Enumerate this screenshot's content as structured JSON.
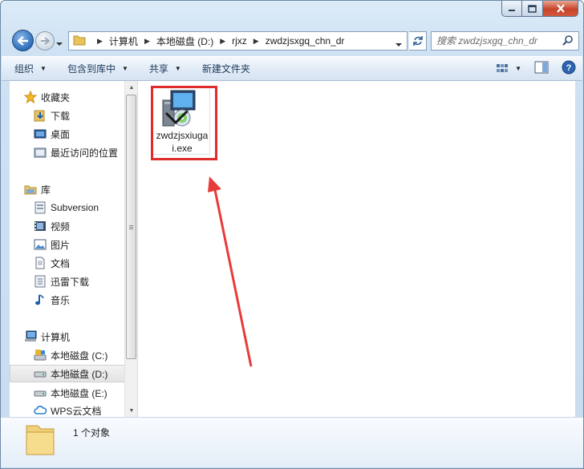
{
  "address": {
    "breadcrumbs": [
      "计算机",
      "本地磁盘 (D:)",
      "rjxz",
      "zwdzjsxgq_chn_dr"
    ]
  },
  "search": {
    "placeholder": "搜索 zwdzjsxgq_chn_dr"
  },
  "toolbar": {
    "organize": "组织",
    "include_in_library": "包含到库中",
    "share": "共享",
    "new_folder": "新建文件夹"
  },
  "sidebar": {
    "items": [
      {
        "label": "收藏夹",
        "icon": "star-icon"
      },
      {
        "label": "下载",
        "icon": "download-folder-icon"
      },
      {
        "label": "桌面",
        "icon": "desktop-icon"
      },
      {
        "label": "最近访问的位置",
        "icon": "recent-places-icon"
      },
      {
        "label": "库",
        "icon": "library-icon"
      },
      {
        "label": "Subversion",
        "icon": "subversion-icon"
      },
      {
        "label": "视频",
        "icon": "video-icon"
      },
      {
        "label": "图片",
        "icon": "picture-icon"
      },
      {
        "label": "文档",
        "icon": "document-icon"
      },
      {
        "label": "迅雷下载",
        "icon": "xunlei-download-icon"
      },
      {
        "label": "音乐",
        "icon": "music-icon"
      },
      {
        "label": "计算机",
        "icon": "computer-icon"
      },
      {
        "label": "本地磁盘 (C:)",
        "icon": "system-drive-icon"
      },
      {
        "label": "本地磁盘 (D:)",
        "icon": "drive-icon"
      },
      {
        "label": "本地磁盘 (E:)",
        "icon": "drive-icon"
      },
      {
        "label": "WPS云文档",
        "icon": "cloud-icon"
      }
    ],
    "selected_index": 13
  },
  "files": [
    {
      "name": "zwdzjsxiugai.exe",
      "icon": "installer-exe-icon"
    }
  ],
  "status": {
    "count_text": "1 个对象"
  },
  "colors": {
    "highlight": "#e02b2b",
    "accent": "#2d6dba"
  }
}
